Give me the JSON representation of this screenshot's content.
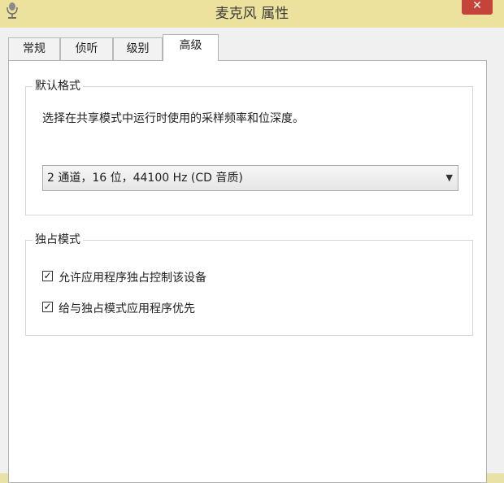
{
  "window": {
    "title": "麦克风 属性",
    "close_glyph": "✕",
    "icon": "microphone-icon"
  },
  "tabs": [
    {
      "label": "常规",
      "active": false
    },
    {
      "label": "侦听",
      "active": false
    },
    {
      "label": "级别",
      "active": false
    },
    {
      "label": "高级",
      "active": true
    }
  ],
  "default_format": {
    "group_label": "默认格式",
    "description": "选择在共享模式中运行时使用的采样频率和位深度。",
    "selected_value": "2 通道，16 位，44100 Hz (CD 音质)",
    "dropdown_icon": "chevron-down-icon"
  },
  "exclusive_mode": {
    "group_label": "独占模式",
    "options": [
      {
        "label": "允许应用程序独占控制该设备",
        "checked": true
      },
      {
        "label": "给与独占模式应用程序优先",
        "checked": true
      }
    ]
  },
  "colors": {
    "titlebar": "#ece29e",
    "close_button": "#c4443a",
    "window_body": "#f0f0f0",
    "panel": "#ffffff"
  }
}
